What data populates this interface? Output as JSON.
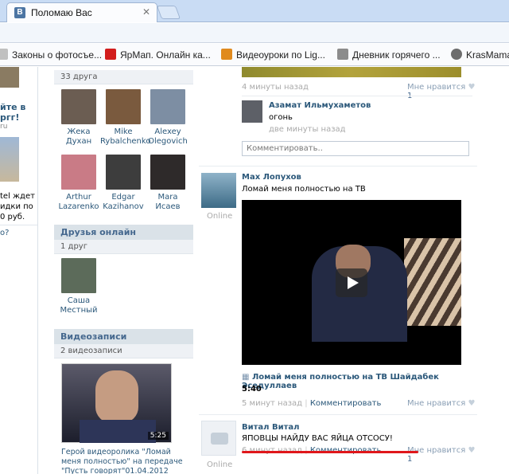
{
  "browser": {
    "tab_title": "Поломаю Вас",
    "tab_favicon": "В",
    "bookmarks": [
      {
        "label": "Законы о фотосъе...",
        "color": "#c0c0c0"
      },
      {
        "label": "ЯрМап. Онлайн ка...",
        "color": "#d21d1d"
      },
      {
        "label": "Видеоуроки по Lig...",
        "color": "#e08a1e"
      },
      {
        "label": "Дневник горячего ...",
        "color": "#8c8c8c"
      },
      {
        "label": "KrasMama",
        "color": "#6d6d6d"
      }
    ]
  },
  "left_edge": {
    "line1": "йте в",
    "line2": "ргг!",
    "line3": "ru",
    "line4": "tel ждет",
    "line5": "идки по",
    "line6": "0 руб.",
    "line7": "о?"
  },
  "sidebar": {
    "friends_count": "33 друга",
    "friends": [
      {
        "name1": "Жека",
        "name2": "Духан",
        "color": "#6b5d52"
      },
      {
        "name1": "Mike",
        "name2": "Rybalchenko",
        "color": "#7a5a3e"
      },
      {
        "name1": "Alexey",
        "name2": "Olegovich",
        "color": "#7d8ea3"
      },
      {
        "name1": "Arthur",
        "name2": "Lazarenko",
        "color": "#c97b86"
      },
      {
        "name1": "Edgar",
        "name2": "Kazihanov",
        "color": "#3d3d3d"
      },
      {
        "name1": "Mara",
        "name2": "Исаев",
        "color": "#2e2a2a"
      }
    ],
    "online_title": "Друзья онлайн",
    "online_count": "1 друг",
    "online_friend": {
      "name1": "Саша",
      "name2": "Местный",
      "color": "#5c6b5a"
    },
    "videos_title": "Видеозаписи",
    "videos_count": "2 видеозаписи",
    "video_duration": "5:25",
    "video_caption": "Герой видеоролика \"Ломай меня полностью\" на передаче \"Пусть говорят\"01.04.2012"
  },
  "feed": {
    "top_time": "4 минуты назад",
    "like_label": "Мне нравится",
    "like_count": "1",
    "comment": {
      "author": "Азамат Ильмухаметов",
      "text": "огонь",
      "time": "две минуты назад"
    },
    "comment_placeholder": "Комментировать..",
    "post1": {
      "author": "Max Лопухов",
      "online": "Online",
      "text": "Ломай меня полностью на ТВ",
      "video_title": "Ломай меня полностью на ТВ Шайдабек Эседуллаев",
      "video_duration": "5:40",
      "time": "5 минут назад",
      "comment_link": "Комментировать"
    },
    "post2": {
      "author": "Витал Витал",
      "online": "Online",
      "text": "ЯПОВЦЫ НАЙДУ ВАС ЯЙЦА ОТСОСУ!",
      "time": "6 минут назад",
      "comment_link": "Комментировать"
    },
    "separator": "|"
  }
}
